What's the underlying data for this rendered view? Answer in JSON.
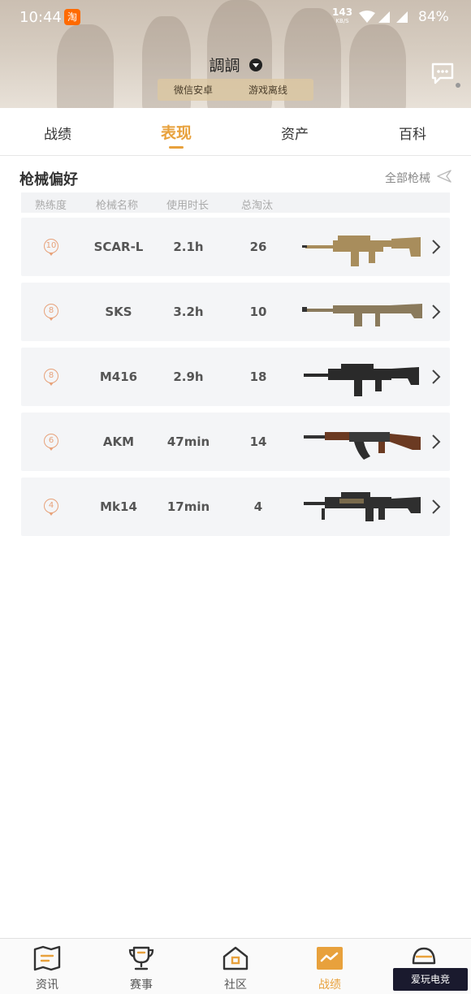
{
  "status_bar": {
    "time": "10:44",
    "app_icon": "淘",
    "net_speed": "143",
    "net_unit": "KB/S",
    "battery": "84%"
  },
  "header": {
    "username": "調調",
    "platform_tag": "微信安卓",
    "status_tag": "游戏离线"
  },
  "tabs": [
    {
      "label": "战绩",
      "active": false
    },
    {
      "label": "表现",
      "active": true
    },
    {
      "label": "资产",
      "active": false
    },
    {
      "label": "百科",
      "active": false
    }
  ],
  "section": {
    "title": "枪械偏好",
    "all_link": "全部枪械"
  },
  "table": {
    "headers": [
      "熟练度",
      "枪械名称",
      "使用时长",
      "总淘汰"
    ],
    "rows": [
      {
        "level": "10",
        "name": "SCAR-L",
        "time": "2.1h",
        "kills": "26",
        "gun_color": "#a88d5c"
      },
      {
        "level": "8",
        "name": "SKS",
        "time": "3.2h",
        "kills": "10",
        "gun_color": "#8a7a5c"
      },
      {
        "level": "8",
        "name": "M416",
        "time": "2.9h",
        "kills": "18",
        "gun_color": "#2a2a2a"
      },
      {
        "level": "6",
        "name": "AKM",
        "time": "47min",
        "kills": "14",
        "gun_color": "#6b3a22"
      },
      {
        "level": "4",
        "name": "Mk14",
        "time": "17min",
        "kills": "4",
        "gun_color": "#2f2f2f"
      }
    ]
  },
  "bottom_nav": [
    {
      "label": "资讯",
      "icon": "news-map-icon",
      "active": false
    },
    {
      "label": "赛事",
      "icon": "trophy-icon",
      "active": false
    },
    {
      "label": "社区",
      "icon": "community-house-icon",
      "active": false
    },
    {
      "label": "战绩",
      "icon": "stats-chart-icon",
      "active": true
    },
    {
      "label": "",
      "icon": "helmet-icon",
      "active": false
    }
  ],
  "colors": {
    "accent": "#e8a13c",
    "rank": "#e7a27a"
  },
  "watermark": "爱玩电竞"
}
